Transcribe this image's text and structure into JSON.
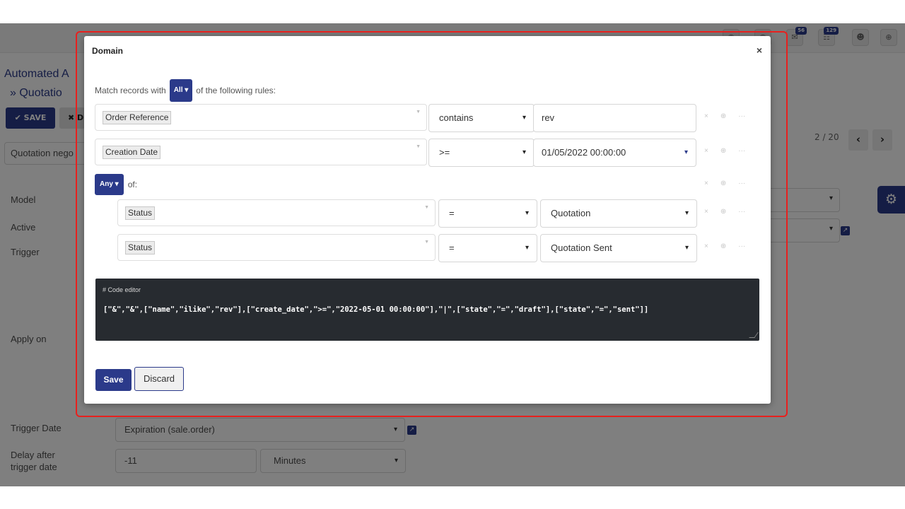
{
  "topbar": {
    "icons": [
      {
        "name": "chat-icon",
        "badge": ""
      },
      {
        "name": "clock-icon",
        "badge": ""
      },
      {
        "name": "message-icon",
        "badge": "56"
      },
      {
        "name": "activity-icon",
        "badge": "129"
      },
      {
        "name": "user-avatar-icon",
        "badge": ""
      },
      {
        "name": "globe-icon",
        "badge": ""
      }
    ]
  },
  "background": {
    "breadcrumb_root": "Automated A",
    "breadcrumb_current": "» Quotatio",
    "save_label": "✔ SAVE",
    "discard_label": "✖ D",
    "record_chip": "Quotation nego",
    "pager_text": "2 / 20",
    "fields": {
      "model": "Model",
      "active": "Active",
      "trigger": "Trigger",
      "apply_on": "Apply on",
      "trigger_date": "Trigger Date",
      "delay_line1": "Delay after",
      "delay_line2": "trigger date"
    },
    "trigger_date_value": "Expiration (sale.order)",
    "delay_value": "-11",
    "delay_unit": "Minutes"
  },
  "modal": {
    "title": "Domain",
    "close": "×",
    "match_prefix": "Match records with",
    "match_mode": "All ▾",
    "match_suffix": "of the following rules:",
    "rules": [
      {
        "field": "Order Reference",
        "operator": "contains",
        "value": "rev"
      },
      {
        "field": "Creation Date",
        "operator": ">=",
        "value": "01/05/2022 00:00:00"
      }
    ],
    "any_mode": "Any ▾",
    "any_suffix": "of:",
    "sub_rules": [
      {
        "field": "Status",
        "operator": "=",
        "value": "Quotation"
      },
      {
        "field": "Status",
        "operator": "=",
        "value": "Quotation Sent"
      }
    ],
    "code_label": "# Code editor",
    "code": "[\"&\",\"&\",[\"name\",\"ilike\",\"rev\"],[\"create_date\",\">=\",\"2022-05-01 00:00:00\"],\"|\",[\"state\",\"=\",\"draft\"],[\"state\",\"=\",\"sent\"]]",
    "save_label": "Save",
    "discard_label": "Discard"
  },
  "icons": {
    "remove": "×",
    "add": "⊕",
    "more": "···",
    "chevron": "❯"
  },
  "colors": {
    "primary": "#2b3a8a",
    "code_bg": "#272b30",
    "highlight": "#e8201e"
  }
}
